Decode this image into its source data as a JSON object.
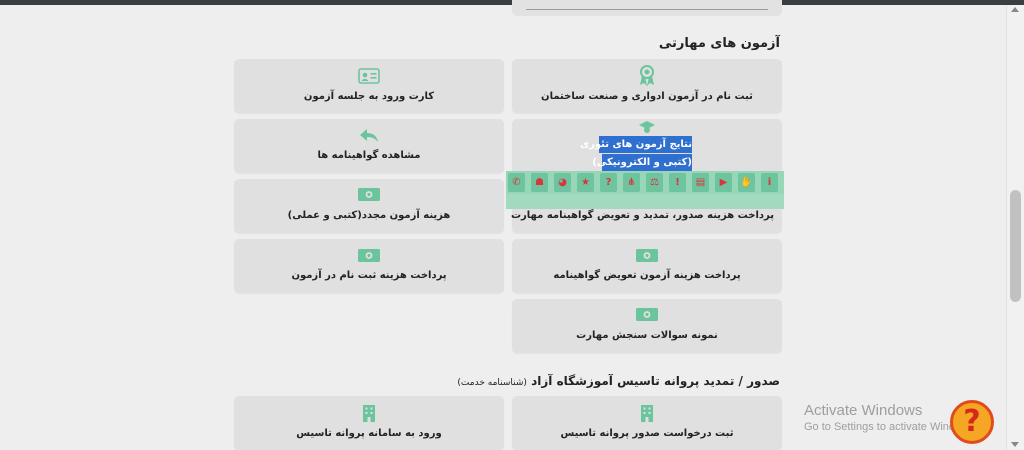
{
  "sections": {
    "skills_exam": "آزمون های مهارتی",
    "license": {
      "main": "صدور / تمدید پروانه تاسیس آموزشگاه آزاد",
      "sub": "(شناسنامه خدمت)"
    }
  },
  "cards": {
    "register_exam": "ثبت نام در آزمون ادواری و صنعت ساختمان",
    "entry_card": "کارت ورود به جلسه آزمون",
    "view_certificate": "مشاهده گواهینامه ها",
    "cert_issue_fee": "پرداخت هزینه صدور، تمدید و تعویض گواهینامه مهارت",
    "retake_fee": "هزینه آزمون مجدد(کتبی و عملی)",
    "cert_exchange_fee": "پرداخت هزینه آزمون تعویض گواهینامه",
    "registration_fee": "پرداخت هزینه ثبت نام در آزمون",
    "sample_questions": "نمونه سوالات سنجش مهارت",
    "license_request": "ثبت درخواست صدور پروانه تاسیس",
    "license_system": "ورود به سامانه پروانه تاسیس"
  },
  "tooltip": {
    "line1": "نتایج آزمون های تئوری",
    "line2": "(کتبی و الکترونیکی)"
  },
  "toolbar_icons": [
    "phone-icon",
    "group-icon",
    "pie-chart-icon",
    "star-icon",
    "question-icon",
    "network-icon",
    "scales-icon",
    "alert-icon",
    "document-icon",
    "video-icon",
    "handshake-icon",
    "info-icon"
  ],
  "watermark": {
    "title": "Activate Windows",
    "subtitle": "Go to Settings to activate Windows."
  },
  "help_button": "?",
  "colors": {
    "accent_green": "#6cc49d",
    "tooltip_blue": "#2e6fcf",
    "toolbar_icon_red": "#d9353b",
    "help_orange": "#f5a623"
  }
}
